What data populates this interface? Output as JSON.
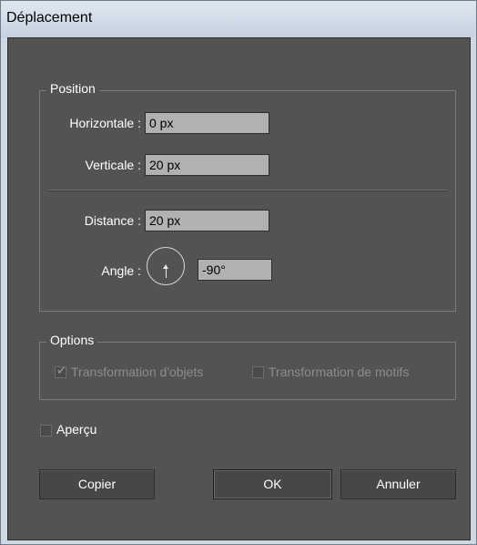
{
  "window": {
    "title": "Déplacement"
  },
  "position": {
    "legend": "Position",
    "horizontal_label": "Horizontale :",
    "horizontal_value": "0 px",
    "vertical_label": "Verticale :",
    "vertical_value": "20 px",
    "distance_label": "Distance :",
    "distance_value": "20 px",
    "angle_label": "Angle :",
    "angle_value": "-90°"
  },
  "options": {
    "legend": "Options",
    "transform_objects_label": "Transformation d'objets",
    "transform_objects_checked": true,
    "transform_patterns_label": "Transformation de motifs",
    "transform_patterns_checked": false
  },
  "preview": {
    "label": "Aperçu",
    "checked": false
  },
  "buttons": {
    "copy": "Copier",
    "ok": "OK",
    "cancel": "Annuler"
  }
}
